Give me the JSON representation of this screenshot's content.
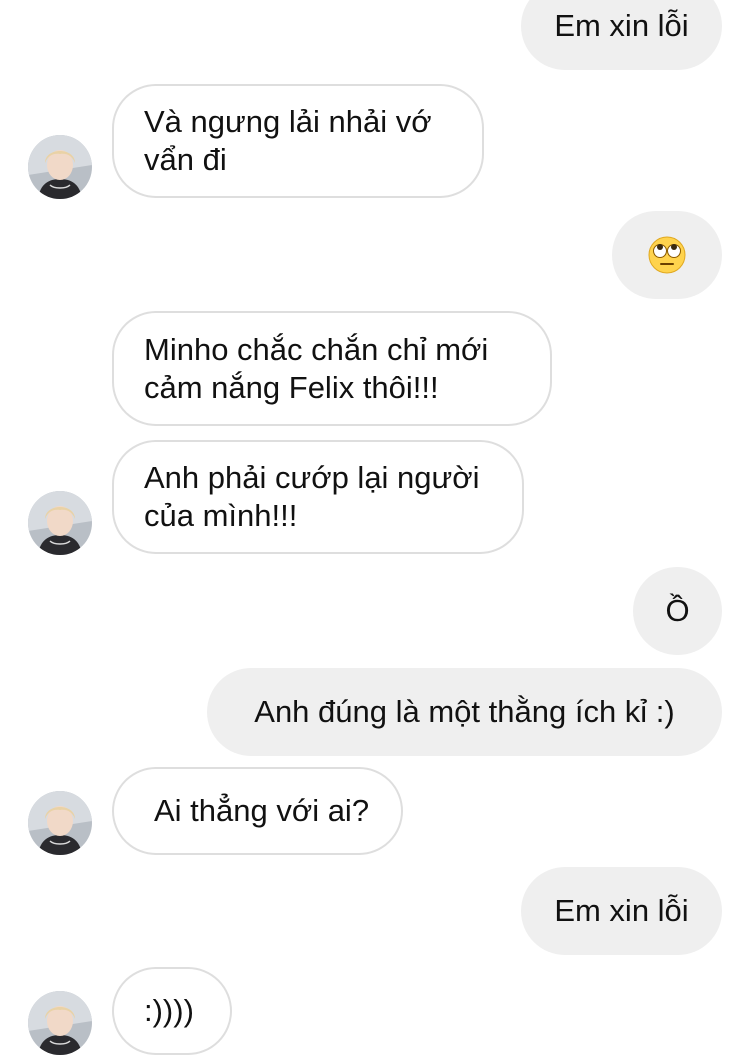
{
  "conversation": {
    "messages": [
      {
        "text": "Em xin lỗi"
      },
      {
        "text": " Và ngưng lải nhải vớ\nvẩn đi"
      },
      {
        "emoji": "face-with-rolling-eyes-icon"
      },
      {
        "text": " Minho chắc chắn chỉ mới\ncảm nắng Felix thôi!!!"
      },
      {
        "text": "Anh phải cướp lại người\ncủa mình!!!"
      },
      {
        "text": "Ồ"
      },
      {
        "text": "Anh đúng là một thằng ích kỉ :)"
      },
      {
        "text": "Ai thẳng với ai?"
      },
      {
        "text": "Em xin lỗi"
      },
      {
        "text": ":))))"
      }
    ]
  },
  "colors": {
    "outgoing_bubble": "#efefef",
    "incoming_border": "#dedede",
    "text": "#111111"
  }
}
